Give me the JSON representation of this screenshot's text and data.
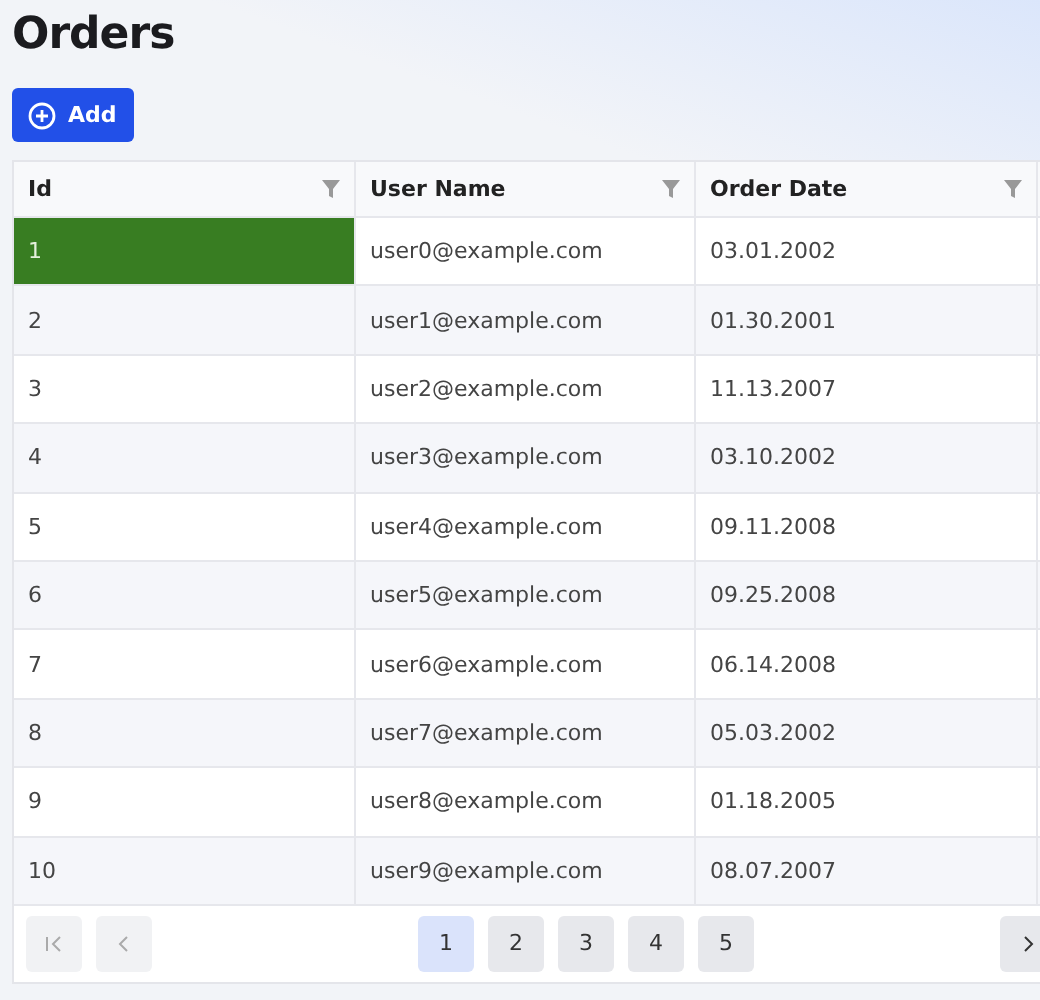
{
  "title": "Orders",
  "add_button": {
    "label": "Add"
  },
  "table": {
    "columns": [
      "Id",
      "User Name",
      "Order Date"
    ],
    "rows": [
      {
        "cells": [
          "1",
          "user0@example.com",
          "03.01.2002"
        ],
        "selected": true
      },
      {
        "cells": [
          "2",
          "user1@example.com",
          "01.30.2001"
        ],
        "selected": false
      },
      {
        "cells": [
          "3",
          "user2@example.com",
          "11.13.2007"
        ],
        "selected": false
      },
      {
        "cells": [
          "4",
          "user3@example.com",
          "03.10.2002"
        ],
        "selected": false
      },
      {
        "cells": [
          "5",
          "user4@example.com",
          "09.11.2008"
        ],
        "selected": false
      },
      {
        "cells": [
          "6",
          "user5@example.com",
          "09.25.2008"
        ],
        "selected": false
      },
      {
        "cells": [
          "7",
          "user6@example.com",
          "06.14.2008"
        ],
        "selected": false
      },
      {
        "cells": [
          "8",
          "user7@example.com",
          "05.03.2002"
        ],
        "selected": false
      },
      {
        "cells": [
          "9",
          "user8@example.com",
          "01.18.2005"
        ],
        "selected": false
      },
      {
        "cells": [
          "10",
          "user9@example.com",
          "08.07.2007"
        ],
        "selected": false
      }
    ]
  },
  "pager": {
    "first_disabled": true,
    "prev_disabled": true,
    "pages": [
      {
        "label": "1",
        "selected": true
      },
      {
        "label": "2",
        "selected": false
      },
      {
        "label": "3",
        "selected": false
      },
      {
        "label": "4",
        "selected": false
      },
      {
        "label": "5",
        "selected": false
      }
    ]
  }
}
